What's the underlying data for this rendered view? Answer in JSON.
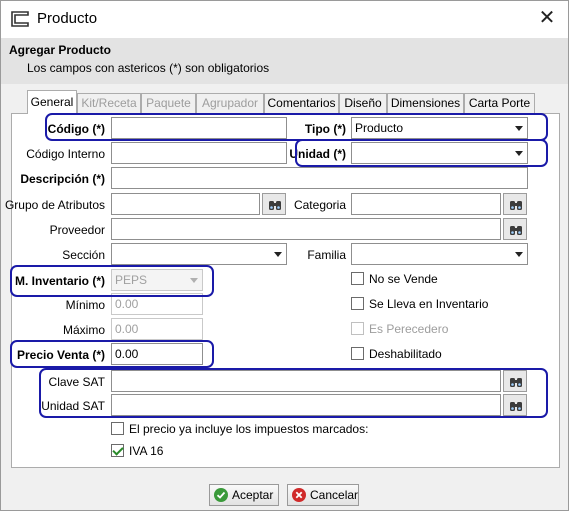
{
  "window": {
    "title": "Producto",
    "close_glyph": "✕"
  },
  "header": {
    "title": "Agregar Producto",
    "subtitle": "Los campos con astericos (*) son obligatorios"
  },
  "tabs": [
    {
      "label": "General",
      "state": "active"
    },
    {
      "label": "Kit/Receta",
      "state": "disabled"
    },
    {
      "label": "Paquete",
      "state": "disabled"
    },
    {
      "label": "Agrupador",
      "state": "disabled"
    },
    {
      "label": "Comentarios",
      "state": "enabled"
    },
    {
      "label": "Diseño",
      "state": "enabled"
    },
    {
      "label": "Dimensiones",
      "state": "enabled"
    },
    {
      "label": "Carta Porte",
      "state": "enabled"
    }
  ],
  "form": {
    "codigo": {
      "label": "Código (*)",
      "value": ""
    },
    "tipo": {
      "label": "Tipo (*)",
      "value": "Producto"
    },
    "codigo_interno": {
      "label": "Código Interno",
      "value": ""
    },
    "unidad": {
      "label": "Unidad (*)",
      "value": ""
    },
    "descripcion": {
      "label": "Descripción (*)",
      "value": ""
    },
    "grupo_atributos": {
      "label": "Grupo de Atributos",
      "value": ""
    },
    "categoria": {
      "label": "Categoria",
      "value": ""
    },
    "proveedor": {
      "label": "Proveedor",
      "value": ""
    },
    "seccion": {
      "label": "Sección",
      "value": ""
    },
    "familia": {
      "label": "Familia",
      "value": ""
    },
    "m_inventario": {
      "label": "M. Inventario (*)",
      "value": "PEPS"
    },
    "minimo": {
      "label": "Mínimo",
      "value": "0.00"
    },
    "maximo": {
      "label": "Máximo",
      "value": "0.00"
    },
    "precio_venta": {
      "label": "Precio Venta (*)",
      "value": "0.00"
    },
    "clave_sat": {
      "label": "Clave SAT",
      "value": ""
    },
    "unidad_sat": {
      "label": "Unidad SAT",
      "value": ""
    }
  },
  "checkboxes": {
    "no_se_vende": {
      "label": "No se Vende",
      "checked": false,
      "enabled": true
    },
    "se_lleva_inventario": {
      "label": "Se Lleva en Inventario",
      "checked": false,
      "enabled": true
    },
    "es_perecedero": {
      "label": "Es Perecedero",
      "checked": false,
      "enabled": false
    },
    "deshabilitado": {
      "label": "Deshabilitado",
      "checked": false,
      "enabled": true
    },
    "precio_incluye_impuestos": {
      "label": "El precio ya incluye los impuestos marcados:",
      "checked": false,
      "enabled": true
    },
    "iva16": {
      "label": "IVA 16",
      "checked": true,
      "enabled": true
    }
  },
  "buttons": {
    "accept": "Aceptar",
    "cancel": "Cancelar"
  },
  "colors": {
    "highlight": "#1a1aa8",
    "accept_icon": "#3a9a3a",
    "cancel_icon": "#d02a2a",
    "header_bg": "#e3e3e3"
  }
}
